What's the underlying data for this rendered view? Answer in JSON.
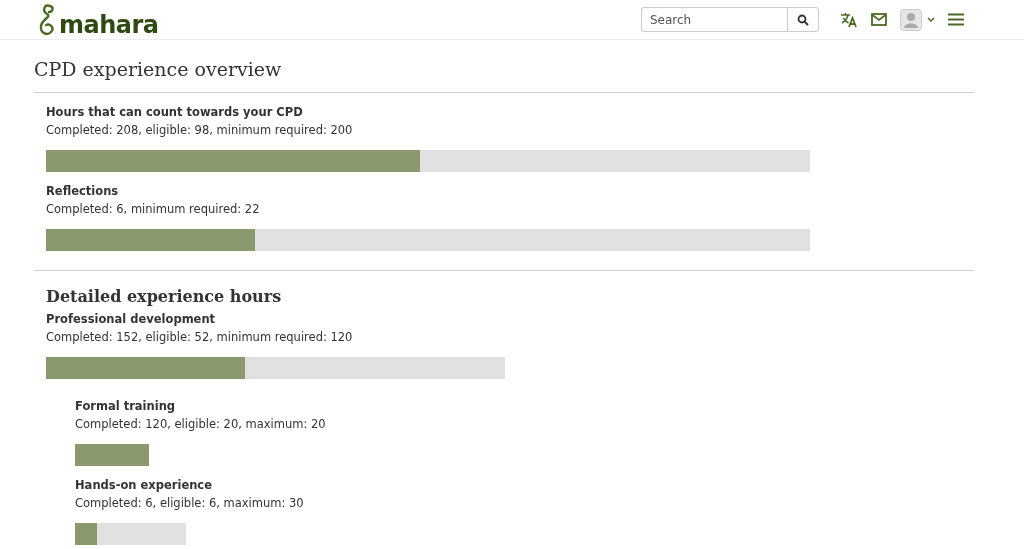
{
  "header": {
    "logo": "mahara",
    "search": {
      "placeholder": "Search"
    }
  },
  "page_title": "CPD experience overview",
  "overview": [
    {
      "title": "Hours that can count towards your CPD",
      "summary": "Completed: 208, eligible: 98, minimum required: 200",
      "level": 0.49
    },
    {
      "title": "Reflections",
      "summary": "Completed: 6, minimum required: 22",
      "level": 0.274
    }
  ],
  "detailed": {
    "heading": "Detailed experience hours",
    "category": {
      "title": "Professional development",
      "summary": "Completed: 152, eligible: 52, minimum required: 120",
      "level": 0.434
    },
    "children": [
      {
        "title": "Formal training",
        "summary": "Completed: 120, eligible: 20, maximum: 20",
        "level": 1.0
      },
      {
        "title": "Hands-on experience",
        "summary": "Completed: 6, eligible: 6, maximum: 30",
        "level": 0.2
      }
    ]
  }
}
